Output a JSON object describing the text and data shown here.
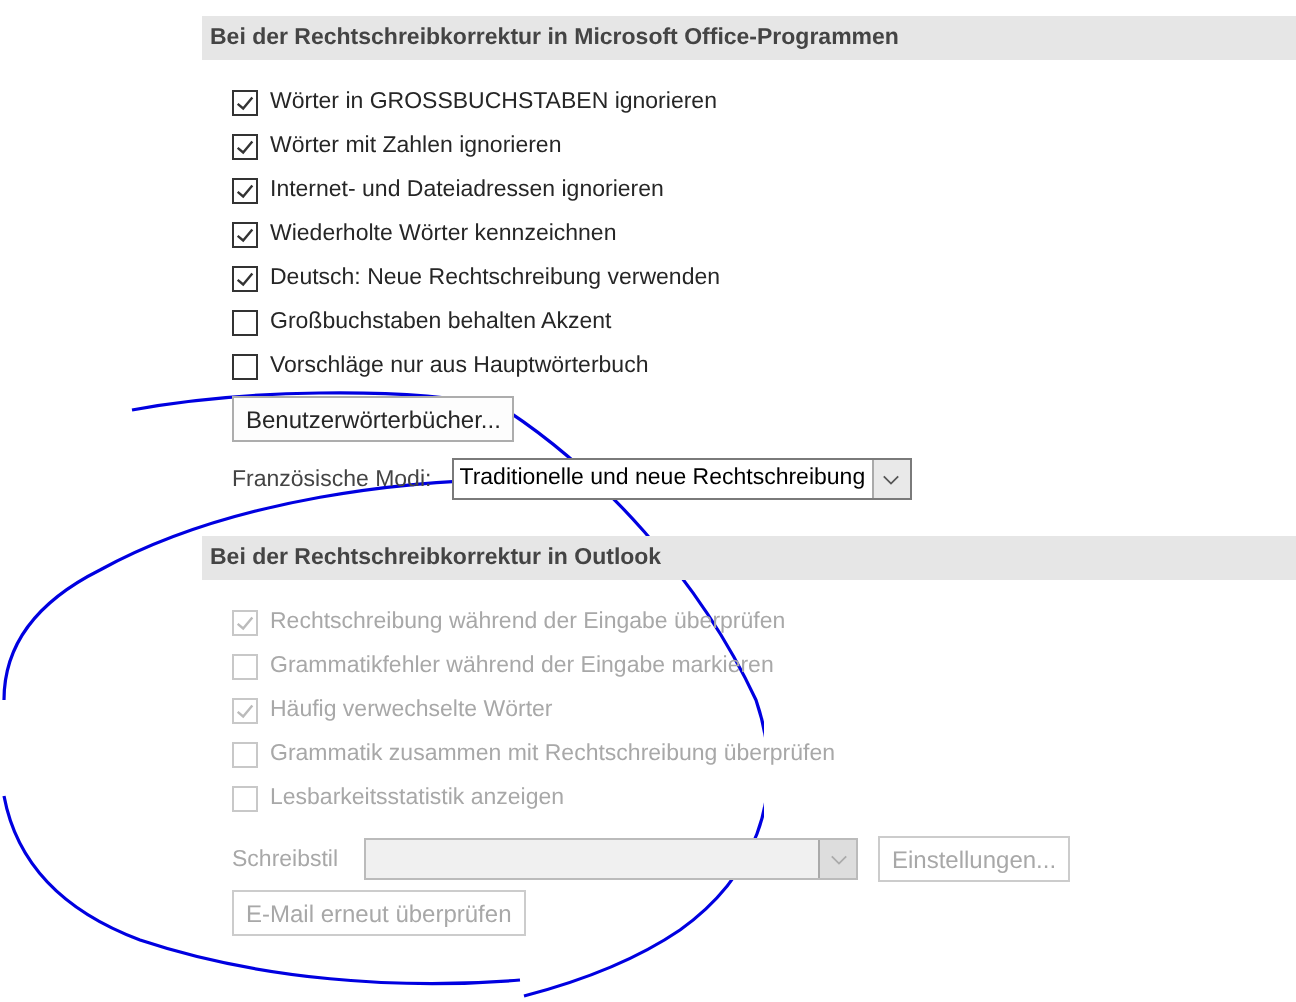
{
  "sections": [
    {
      "title": "Bei der Rechtschreibkorrektur in Microsoft Office-Programmen",
      "options": [
        {
          "label": "Wörter in GROSSBUCHSTABEN ignorieren",
          "checked": true,
          "disabled": false
        },
        {
          "label": "Wörter mit Zahlen ignorieren",
          "checked": true,
          "disabled": false
        },
        {
          "label": "Internet- und Dateiadressen ignorieren",
          "checked": true,
          "disabled": false
        },
        {
          "label": "Wiederholte Wörter kennzeichnen",
          "checked": true,
          "disabled": false
        },
        {
          "label": "Deutsch: Neue Rechtschreibung verwenden",
          "checked": true,
          "disabled": false
        },
        {
          "label": "Großbuchstaben behalten Akzent",
          "checked": false,
          "disabled": false
        },
        {
          "label": "Vorschläge nur aus Hauptwörterbuch",
          "checked": false,
          "disabled": false
        }
      ],
      "controls": [
        {
          "kind": "button",
          "label": "Benutzerwörterbücher...",
          "disabled": false
        },
        {
          "kind": "select",
          "label": "Französische Modi:",
          "value": "Traditionelle und neue Rechtschreibung",
          "disabled": false
        }
      ]
    },
    {
      "title": "Bei der Rechtschreibkorrektur in Outlook",
      "options": [
        {
          "label": "Rechtschreibung während der Eingabe überprüfen",
          "checked": true,
          "disabled": true
        },
        {
          "label": "Grammatikfehler während der Eingabe markieren",
          "checked": false,
          "disabled": true
        },
        {
          "label": "Häufig verwechselte Wörter",
          "checked": true,
          "disabled": true
        },
        {
          "label": "Grammatik zusammen mit Rechtschreibung überprüfen",
          "checked": false,
          "disabled": true
        },
        {
          "label": "Lesbarkeitsstatistik anzeigen",
          "checked": false,
          "disabled": true
        }
      ],
      "controls": [
        {
          "kind": "select_button",
          "label": "Schreibstil",
          "button": "Einstellungen...",
          "disabled": true
        },
        {
          "kind": "button",
          "label": "E-Mail erneut überprüfen",
          "disabled": true
        }
      ]
    }
  ]
}
